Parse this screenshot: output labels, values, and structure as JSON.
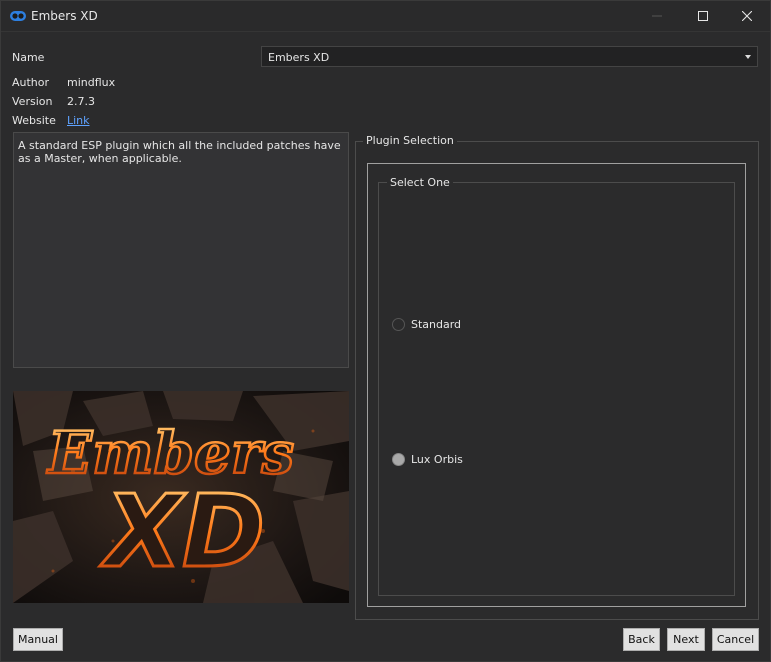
{
  "window": {
    "title": "Embers XD",
    "icon": "fomod-app-icon"
  },
  "info": {
    "name_label": "Name",
    "name_value": "Embers XD",
    "author_label": "Author",
    "author_value": "mindflux",
    "version_label": "Version",
    "version_value": "2.7.3",
    "website_label": "Website",
    "website_value": "Link"
  },
  "description": "A standard ESP plugin which all the included patches have as a Master, when applicable.",
  "banner": {
    "title_line1": "Embers",
    "title_line2": "XD"
  },
  "plugin_selection": {
    "title": "Plugin Selection",
    "group_title": "Select One",
    "options": [
      {
        "label": "Standard",
        "checked": false
      },
      {
        "label": "Lux Orbis",
        "checked": true
      }
    ]
  },
  "buttons": {
    "manual": "Manual",
    "back": "Back",
    "next": "Next",
    "cancel": "Cancel"
  },
  "colors": {
    "background": "#2b2b2c",
    "link": "#5ea2ff",
    "button_bg": "#e1e1e1",
    "ember_orange": "#ff7a1a"
  }
}
